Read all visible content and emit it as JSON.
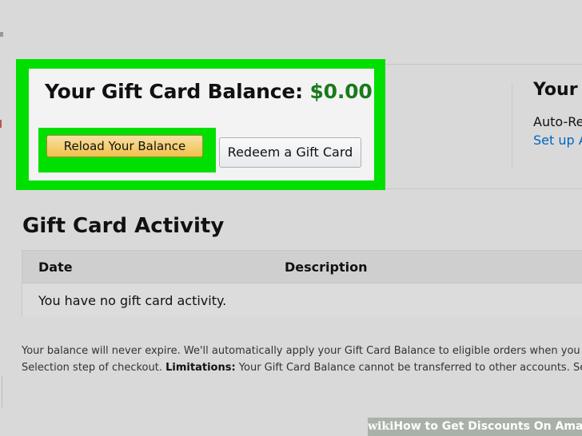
{
  "balance": {
    "label": "Your Gift Card Balance:",
    "amount": "$0.00",
    "reload_button": "Reload Your Balance",
    "redeem_button": "Redeem a Gift Card"
  },
  "right_panel": {
    "title": "Your A",
    "auto_text": "Auto-Re",
    "setup_link": "Set up A"
  },
  "activity": {
    "title": "Gift Card Activity",
    "columns": [
      "Date",
      "Description"
    ],
    "empty_message": "You have no gift card activity."
  },
  "footnote": {
    "line1": "Your balance will never expire. We'll automatically apply your Gift Card Balance to eligible orders when you c",
    "line2_start": "Selection step of checkout.",
    "line2_bold": "Limitations:",
    "line2_end": "Your Gift Card Balance cannot be transferred to other accounts. See"
  },
  "watermark": {
    "logo": "wiki",
    "title": "How to Get Discounts On Amazon"
  },
  "colors": {
    "highlight": "#00e000",
    "amount_green": "#1a7a1a",
    "link_blue": "#0066c0",
    "reload_button": "#f0c14b"
  }
}
